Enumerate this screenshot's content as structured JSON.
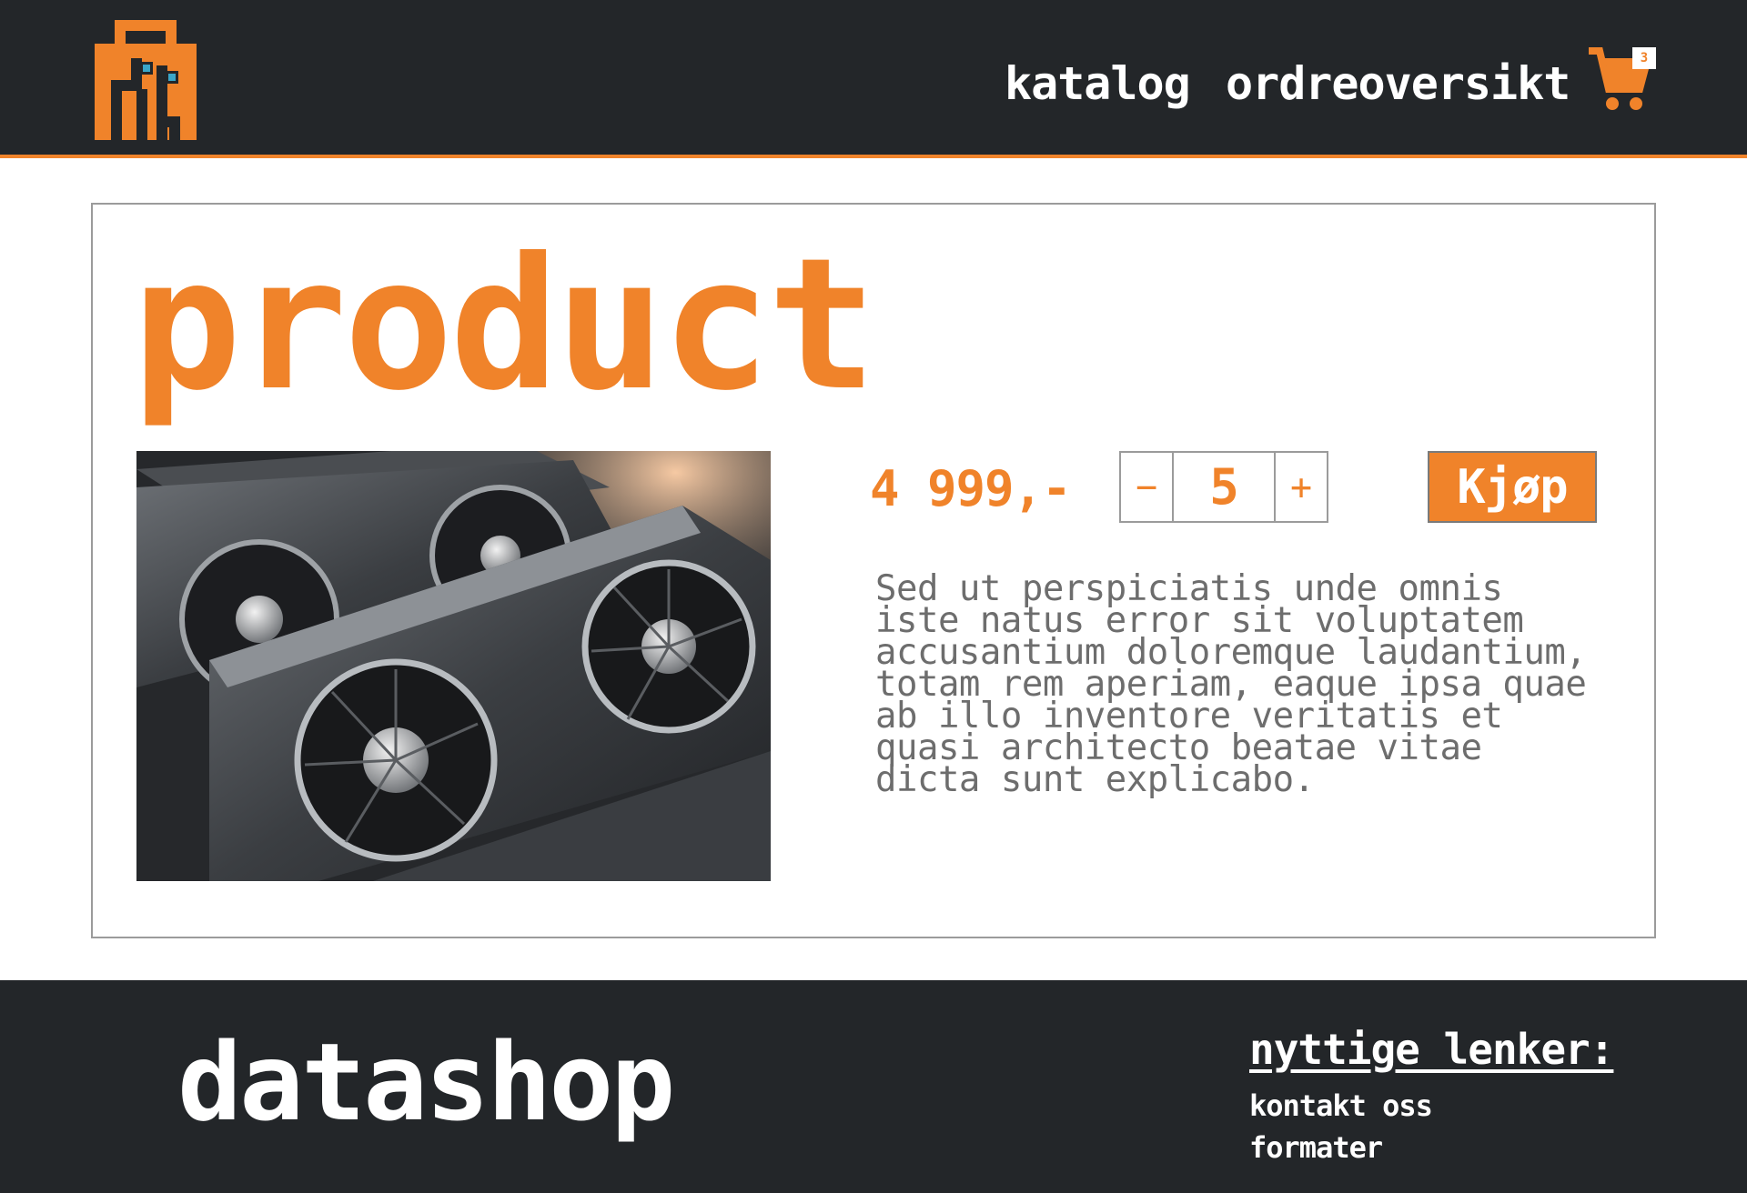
{
  "header": {
    "nav": {
      "catalog": "katalog",
      "orders": "ordreoversikt"
    },
    "cart": {
      "icon": "shopping-cart-icon",
      "count": "3"
    }
  },
  "product": {
    "title": "product",
    "price": "4 999,-",
    "quantity": "5",
    "minus_label": "−",
    "plus_label": "+",
    "buy_label": "Kjøp",
    "description": "Sed ut perspiciatis unde omnis iste natus error sit voluptatem accusantium doloremque laudantium, totam rem aperiam, eaque ipsa quae ab illo inventore veritatis et quasi architecto beatae vitae dicta sunt explicabo."
  },
  "footer": {
    "brand": "datashop",
    "links_title": "nyttige lenker:",
    "links": [
      "kontakt oss",
      "formater"
    ]
  },
  "colors": {
    "accent": "#f0832a",
    "dark": "#232629",
    "text_gray": "#6d6d6d",
    "border": "#9b9b9b"
  }
}
